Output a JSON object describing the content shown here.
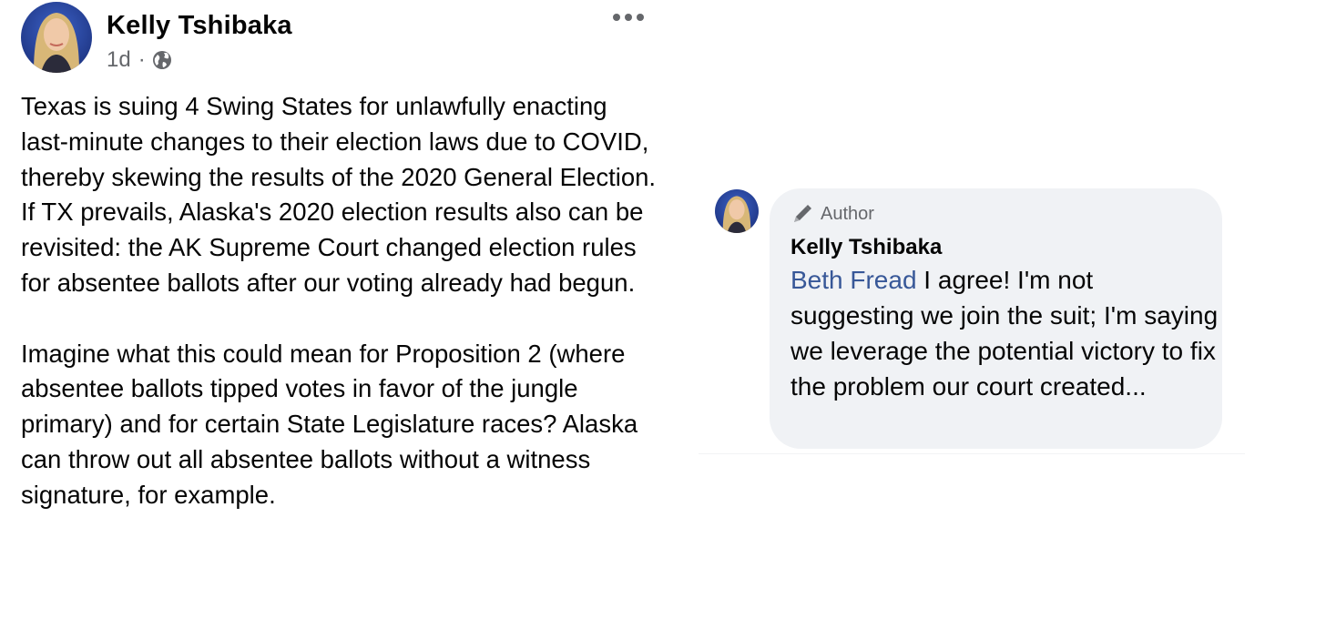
{
  "post": {
    "author": "Kelly Tshibaka",
    "timestamp": "1d",
    "separator": "·",
    "privacy_icon": "globe-icon",
    "more_icon": "more-options-icon",
    "paragraphs": [
      "Texas is suing 4 Swing States for unlawfully enacting last-minute changes to their election laws due to COVID, thereby skewing the results of the 2020 General Election. If TX prevails, Alaska's 2020 election results also can be revisited: the AK Supreme Court changed election rules for absentee ballots after our voting already had begun.",
      "Imagine what this could mean for Proposition 2 (where absentee ballots tipped votes in favor of the jungle primary) and for certain State Legislature races? Alaska can throw out all absentee ballots without a witness signature, for example."
    ]
  },
  "comment": {
    "badge": "Author",
    "badge_icon": "pen-icon",
    "author": "Kelly Tshibaka",
    "mention": "Beth Fread",
    "text": " I agree! I'm not suggesting we join the suit; I'm saying we leverage the potential victory to fix the problem our court created..."
  },
  "colors": {
    "mention": "#385898",
    "bubble": "#f0f2f5",
    "secondary_text": "#65676b"
  }
}
